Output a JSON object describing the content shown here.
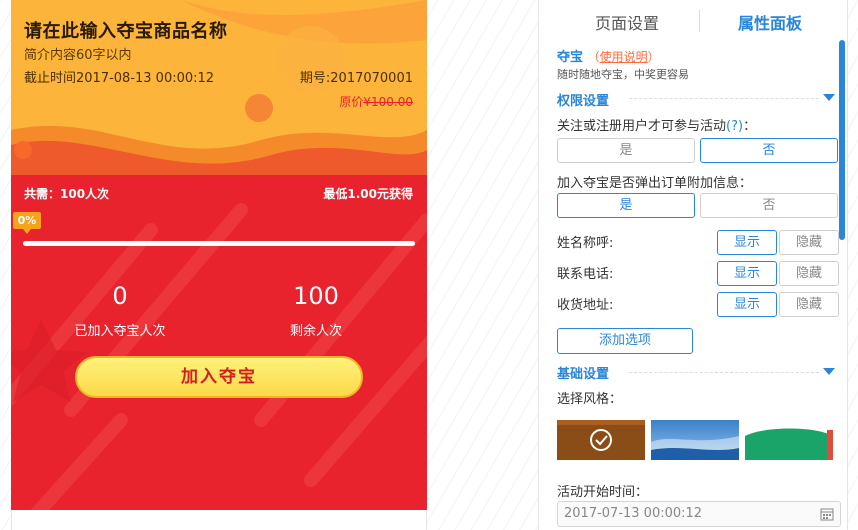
{
  "preview": {
    "title": "请在此输入夺宝商品名称",
    "desc": "简介内容60字以内",
    "deadline": "截止时间2017-08-13 00:00:12",
    "period": "期号:2017070001",
    "original_label": "原价",
    "original_price": "¥100.00",
    "need": "共需：100人次",
    "min_price": "最低1.00元获得",
    "progress_text": "0%",
    "progress": 0,
    "joined": "0",
    "joined_label": "已加入夺宝人次",
    "remaining": "100",
    "remaining_label": "剩余人次",
    "join_button": "加入夺宝"
  },
  "panel": {
    "tabs": [
      "页面设置",
      "属性面板"
    ],
    "intro": {
      "title": "夺宝",
      "help_paren_open": "（",
      "help_link": "使用说明",
      "help_paren_close": "）",
      "subtitle": "随时随地夺宝，中奖更容易"
    },
    "permission": {
      "title": "权限设置",
      "follow_label": "关注或注册用户才可参与活动",
      "follow_q": "(?)",
      "follow_colon": "：",
      "follow_options": [
        "是",
        "否"
      ],
      "popup_label": "加入夺宝是否弹出订单附加信息：",
      "popup_options": [
        "是",
        "否"
      ],
      "fields": [
        {
          "label": "姓名称呼:",
          "show": "显示",
          "hide": "隐藏"
        },
        {
          "label": "联系电话:",
          "show": "显示",
          "hide": "隐藏"
        },
        {
          "label": "收货地址:",
          "show": "显示",
          "hide": "隐藏"
        }
      ],
      "add_option": "添加选项"
    },
    "basic": {
      "title": "基础设置",
      "style_label": "选择风格：",
      "start_label": "活动开始时间：",
      "start_value": "2017-07-13 00:00:12"
    }
  },
  "colors": {
    "accent": "#2a86d9",
    "preview_red": "#e8232d",
    "preview_orange": "#f7a21b"
  }
}
